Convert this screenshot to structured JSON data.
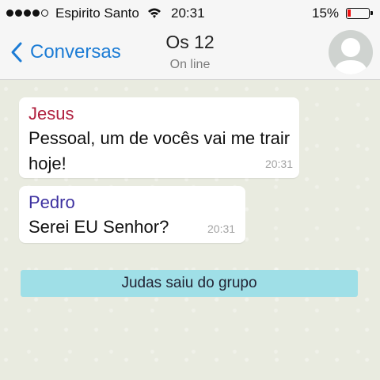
{
  "status_bar": {
    "carrier": "Espirito Santo",
    "time": "20:31",
    "battery_percent": "15%",
    "battery_level": 0.15,
    "signal_bars": 4,
    "signal_bars_total": 5
  },
  "nav": {
    "back_label": "Conversas",
    "title": "Os 12",
    "subtitle": "On line",
    "back_icon": "chevron-left-icon",
    "avatar_icon": "person-silhouette-icon"
  },
  "colors": {
    "back_blue": "#1c7cd5",
    "jesus_name": "#b0203f",
    "pedro_name": "#3d31a0",
    "system_banner": "#9fdfe7",
    "chat_background": "#e9ebe0"
  },
  "messages": [
    {
      "sender": "Jesus",
      "text": "Pessoal, um de vocês vai me trair hoje!",
      "time": "20:31"
    },
    {
      "sender": "Pedro",
      "text": "Serei EU Senhor?",
      "time": "20:31"
    }
  ],
  "system_message": "Judas saiu do grupo"
}
